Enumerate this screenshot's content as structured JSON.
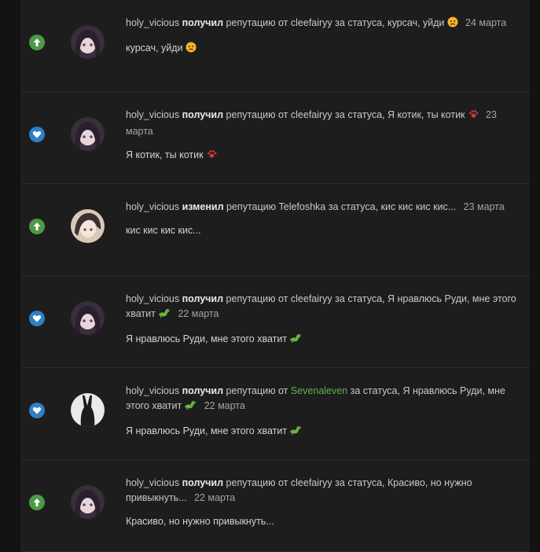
{
  "items": [
    {
      "icon": "arrow-up-icon",
      "user": "holy_vicious",
      "verb": "получил",
      "mid": "репутацию от",
      "from": "cleefairyy",
      "from_highlight": false,
      "reason": "за статуса, курсач, уйди",
      "emoji": "sad-face-emoji",
      "date": "24 марта",
      "quote": "курсач, уйди"
    },
    {
      "icon": "heart-icon",
      "user": "holy_vicious",
      "verb": "получил",
      "mid": "репутацию от",
      "from": "cleefairyy",
      "from_highlight": false,
      "reason": "за статуса, Я котик, ты котик",
      "emoji": "paw-emoji",
      "date": "23 марта",
      "quote": "Я котик, ты котик"
    },
    {
      "icon": "arrow-up-icon",
      "user": "holy_vicious",
      "verb": "изменил",
      "mid": "репутацию",
      "from": "Telefoshka",
      "from_highlight": false,
      "reason": "за статуса, кис кис кис кис...",
      "emoji": "",
      "date": "23 марта",
      "quote": "кис кис кис кис..."
    },
    {
      "icon": "heart-icon",
      "user": "holy_vicious",
      "verb": "получил",
      "mid": "репутацию от",
      "from": "cleefairyy",
      "from_highlight": false,
      "reason": "за статуса, Я нравлюсь Руди, мне этого хватит",
      "emoji": "dinosaur-emoji",
      "date": "22 марта",
      "quote": "Я нравлюсь Руди, мне этого хватит"
    },
    {
      "icon": "heart-icon",
      "user": "holy_vicious",
      "verb": "получил",
      "mid": "репутацию от",
      "from": "Sevenaleven",
      "from_highlight": true,
      "reason": "за статуса, Я нравлюсь Руди, мне этого хватит",
      "emoji": "dinosaur-emoji",
      "date": "22 марта",
      "quote": "Я нравлюсь Руди, мне этого хватит"
    },
    {
      "icon": "arrow-up-icon",
      "user": "holy_vicious",
      "verb": "получил",
      "mid": "репутацию от",
      "from": "cleefairyy",
      "from_highlight": false,
      "reason": "за статуса, Красиво, но нужно привыкнуть...",
      "emoji": "",
      "date": "22 марта",
      "quote": "Красиво, но нужно привыкнуть..."
    }
  ],
  "colors": {
    "background": "#121212",
    "panel": "#1d1d1d",
    "up": "#4c9a47",
    "like": "#2f7fc4",
    "highlight_user": "#5fb24d"
  }
}
